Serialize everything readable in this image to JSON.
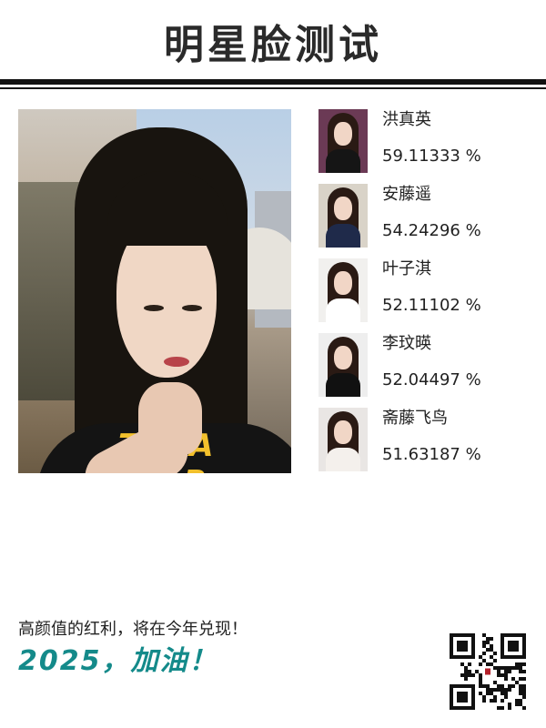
{
  "header": {
    "title": "明星脸测试"
  },
  "user_photo": {
    "alt": ""
  },
  "matches": [
    {
      "name": "洪真英",
      "percent": "59.11333 %",
      "bg": "#6b3a55",
      "body": "#151515"
    },
    {
      "name": "安藤遥",
      "percent": "54.24296 %",
      "bg": "#d9d3c8",
      "body": "#1f2a4a"
    },
    {
      "name": "叶子淇",
      "percent": "52.11102 %",
      "bg": "#f1f0ee",
      "body": "#ffffff"
    },
    {
      "name": "李玟暎",
      "percent": "52.04497 %",
      "bg": "#eeeeee",
      "body": "#111111"
    },
    {
      "name": "斋藤飞鸟",
      "percent": "51.63187 %",
      "bg": "#e9e6e4",
      "body": "#f4f0ec"
    }
  ],
  "footer": {
    "slogan": "高颜值的红利，将在今年兑现！",
    "cheer": "2025，加油！"
  },
  "colors": {
    "accent": "#148a8a",
    "rule": "#111111"
  },
  "qr_code": {
    "icon": "qr-code-icon"
  }
}
